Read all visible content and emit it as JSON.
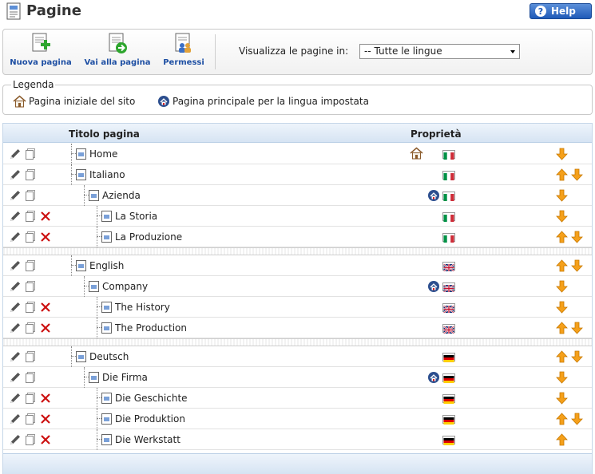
{
  "header": {
    "title": "Pagine",
    "help_label": "Help"
  },
  "toolbar": {
    "new_page_label": "Nuova pagina",
    "goto_page_label": "Vai alla pagina",
    "permissions_label": "Permessi",
    "languages_label": "Visualizza le pagine in:",
    "languages_selected": "-- Tutte le lingue"
  },
  "legend": {
    "title": "Legenda",
    "home_label": "Pagina iniziale del sito",
    "lang_home_label": "Pagina principale per la lingua impostata"
  },
  "table": {
    "col_title": "Titolo pagina",
    "col_props": "Proprietà"
  },
  "colors": {
    "accent": "#1f5ab8",
    "header_bg": "#d6e4f3",
    "arrow": "#f5a01a",
    "delete": "#cc1111"
  },
  "rows": [
    {
      "title": "Home",
      "level": 1,
      "delete": false,
      "home": true,
      "lang_home": false,
      "flag": "it",
      "up": false,
      "down": true
    },
    {
      "title": "Italiano",
      "level": 1,
      "delete": false,
      "home": false,
      "lang_home": false,
      "flag": "it",
      "up": true,
      "down": true
    },
    {
      "title": "Azienda",
      "level": 2,
      "delete": false,
      "home": false,
      "lang_home": true,
      "flag": "it",
      "up": false,
      "down": true
    },
    {
      "title": "La Storia",
      "level": 3,
      "delete": true,
      "home": false,
      "lang_home": false,
      "flag": "it",
      "up": false,
      "down": true
    },
    {
      "title": "La Produzione",
      "level": 3,
      "delete": true,
      "home": false,
      "lang_home": false,
      "flag": "it",
      "up": true,
      "down": true
    },
    {
      "gap": true
    },
    {
      "title": "English",
      "level": 1,
      "delete": false,
      "home": false,
      "lang_home": false,
      "flag": "gb",
      "up": true,
      "down": true
    },
    {
      "title": "Company",
      "level": 2,
      "delete": false,
      "home": false,
      "lang_home": true,
      "flag": "gb",
      "up": false,
      "down": true
    },
    {
      "title": "The History",
      "level": 3,
      "delete": true,
      "home": false,
      "lang_home": false,
      "flag": "gb",
      "up": false,
      "down": true
    },
    {
      "title": "The Production",
      "level": 3,
      "delete": true,
      "home": false,
      "lang_home": false,
      "flag": "gb",
      "up": true,
      "down": true
    },
    {
      "gap": true
    },
    {
      "title": "Deutsch",
      "level": 1,
      "delete": false,
      "home": false,
      "lang_home": false,
      "flag": "de",
      "up": true,
      "down": true
    },
    {
      "title": "Die Firma",
      "level": 2,
      "delete": false,
      "home": false,
      "lang_home": true,
      "flag": "de",
      "up": false,
      "down": true
    },
    {
      "title": "Die Geschichte",
      "level": 3,
      "delete": true,
      "home": false,
      "lang_home": false,
      "flag": "de",
      "up": false,
      "down": true
    },
    {
      "title": "Die Produktion",
      "level": 3,
      "delete": true,
      "home": false,
      "lang_home": false,
      "flag": "de",
      "up": true,
      "down": true
    },
    {
      "title": "Die Werkstatt",
      "level": 3,
      "delete": true,
      "home": false,
      "lang_home": false,
      "flag": "de",
      "up": true,
      "down": false
    }
  ]
}
